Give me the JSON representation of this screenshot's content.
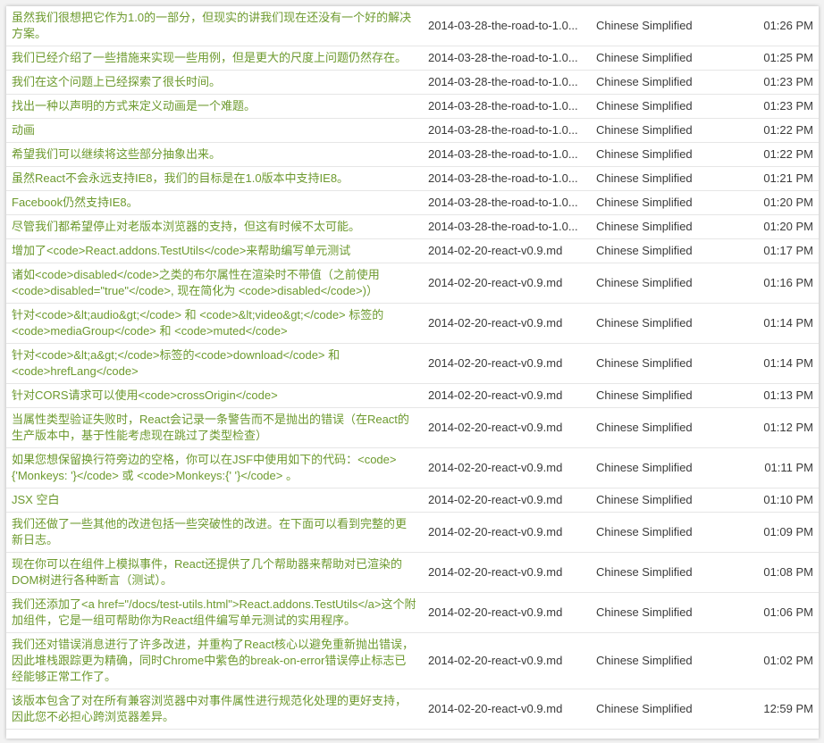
{
  "rows": [
    {
      "text": "虽然我们很想把它作为1.0的一部分，但现实的讲我们现在还没有一个好的解决方案。",
      "file": "2014-03-28-the-road-to-1.0...",
      "language": "Chinese Simplified",
      "time": "01:26 PM"
    },
    {
      "text": "我们已经介绍了一些措施来实现一些用例，但是更大的尺度上问题仍然存在。",
      "file": "2014-03-28-the-road-to-1.0...",
      "language": "Chinese Simplified",
      "time": "01:25 PM"
    },
    {
      "text": "我们在这个问题上已经探索了很长时间。",
      "file": "2014-03-28-the-road-to-1.0...",
      "language": "Chinese Simplified",
      "time": "01:23 PM"
    },
    {
      "text": "找出一种以声明的方式来定义动画是一个难题。",
      "file": "2014-03-28-the-road-to-1.0...",
      "language": "Chinese Simplified",
      "time": "01:23 PM"
    },
    {
      "text": "动画",
      "file": "2014-03-28-the-road-to-1.0...",
      "language": "Chinese Simplified",
      "time": "01:22 PM"
    },
    {
      "text": "希望我们可以继续将这些部分抽象出来。",
      "file": "2014-03-28-the-road-to-1.0...",
      "language": "Chinese Simplified",
      "time": "01:22 PM"
    },
    {
      "text": "虽然React不会永远支持IE8，我们的目标是在1.0版本中支持IE8。",
      "file": "2014-03-28-the-road-to-1.0...",
      "language": "Chinese Simplified",
      "time": "01:21 PM"
    },
    {
      "text": "Facebook仍然支持IE8。",
      "file": "2014-03-28-the-road-to-1.0...",
      "language": "Chinese Simplified",
      "time": "01:20 PM"
    },
    {
      "text": "尽管我们都希望停止对老版本浏览器的支持，但这有时候不太可能。",
      "file": "2014-03-28-the-road-to-1.0...",
      "language": "Chinese Simplified",
      "time": "01:20 PM"
    },
    {
      "text": "增加了<code>React.addons.TestUtils</code>来帮助编写单元测试",
      "file": "2014-02-20-react-v0.9.md",
      "language": "Chinese Simplified",
      "time": "01:17 PM"
    },
    {
      "text": "诸如<code>disabled</code>之类的布尔属性在渲染时不带值（之前使用<code>disabled=\"true\"</code>, 现在简化为 <code>disabled</code>)）",
      "file": "2014-02-20-react-v0.9.md",
      "language": "Chinese Simplified",
      "time": "01:16 PM"
    },
    {
      "text": "针对<code>&lt;audio&gt;</code> 和 <code>&lt;video&gt;</code> 标签的<code>mediaGroup</code> 和 <code>muted</code>",
      "file": "2014-02-20-react-v0.9.md",
      "language": "Chinese Simplified",
      "time": "01:14 PM"
    },
    {
      "text": "针对<code>&lt;a&gt;</code>标签的<code>download</code> 和<code>hrefLang</code>",
      "file": "2014-02-20-react-v0.9.md",
      "language": "Chinese Simplified",
      "time": "01:14 PM"
    },
    {
      "text": "针对CORS请求可以使用<code>crossOrigin</code>",
      "file": "2014-02-20-react-v0.9.md",
      "language": "Chinese Simplified",
      "time": "01:13 PM"
    },
    {
      "text": "当属性类型验证失败时，React会记录一条警告而不是抛出的错误（在React的生产版本中，基于性能考虑现在跳过了类型检查）",
      "file": "2014-02-20-react-v0.9.md",
      "language": "Chinese Simplified",
      "time": "01:12 PM"
    },
    {
      "text": "如果您想保留换行符旁边的空格，你可以在JSF中使用如下的代码：<code>{'Monkeys: '}</code> 或 <code>Monkeys:{' '}</code> 。",
      "file": "2014-02-20-react-v0.9.md",
      "language": "Chinese Simplified",
      "time": "01:11 PM"
    },
    {
      "text": "JSX 空白",
      "file": "2014-02-20-react-v0.9.md",
      "language": "Chinese Simplified",
      "time": "01:10 PM"
    },
    {
      "text": "我们还做了一些其他的改进包括一些突破性的改进。在下面可以看到完整的更新日志。",
      "file": "2014-02-20-react-v0.9.md",
      "language": "Chinese Simplified",
      "time": "01:09 PM"
    },
    {
      "text": "现在你可以在组件上模拟事件，React还提供了几个帮助器来帮助对已渲染的DOM树进行各种断言（测试）。",
      "file": "2014-02-20-react-v0.9.md",
      "language": "Chinese Simplified",
      "time": "01:08 PM"
    },
    {
      "text": "我们还添加了<a href=\"/docs/test-utils.html\">React.addons.TestUtils</a>这个附加组件，它是一组可帮助你为React组件编写单元测试的实用程序。",
      "file": "2014-02-20-react-v0.9.md",
      "language": "Chinese Simplified",
      "time": "01:06 PM"
    },
    {
      "text": "我们还对错误消息进行了许多改进，并重构了React核心以避免重新抛出错误，因此堆栈跟踪更为精确，同时Chrome中紫色的break-on-error错误停止标志已经能够正常工作了。",
      "file": "2014-02-20-react-v0.9.md",
      "language": "Chinese Simplified",
      "time": "01:02 PM"
    },
    {
      "text": "该版本包含了对在所有兼容浏览器中对事件属性进行规范化处理的更好支持，因此您不必担心跨浏览器差异。",
      "file": "2014-02-20-react-v0.9.md",
      "language": "Chinese Simplified",
      "time": "12:59 PM"
    }
  ]
}
